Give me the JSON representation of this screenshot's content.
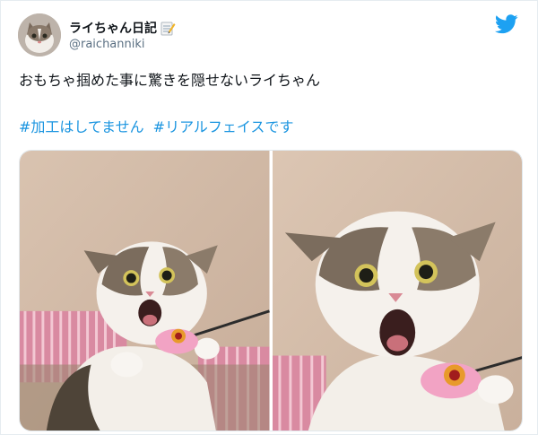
{
  "tweet": {
    "display_name": "ライちゃん日記",
    "handle": "@raichanniki",
    "text": "おもちゃ掴めた事に驚きを隠せないライちゃん",
    "hashtags": [
      "#加工はしてません",
      "#リアルフェイス",
      "です"
    ]
  },
  "icons": {
    "avatar": "cat-avatar",
    "name_emoji": "memo-icon",
    "brand": "twitter-bird-icon"
  },
  "colors": {
    "link": "#1b95e0",
    "brand": "#1da1f2",
    "text": "#0f1419",
    "secondary": "#5b7083"
  }
}
